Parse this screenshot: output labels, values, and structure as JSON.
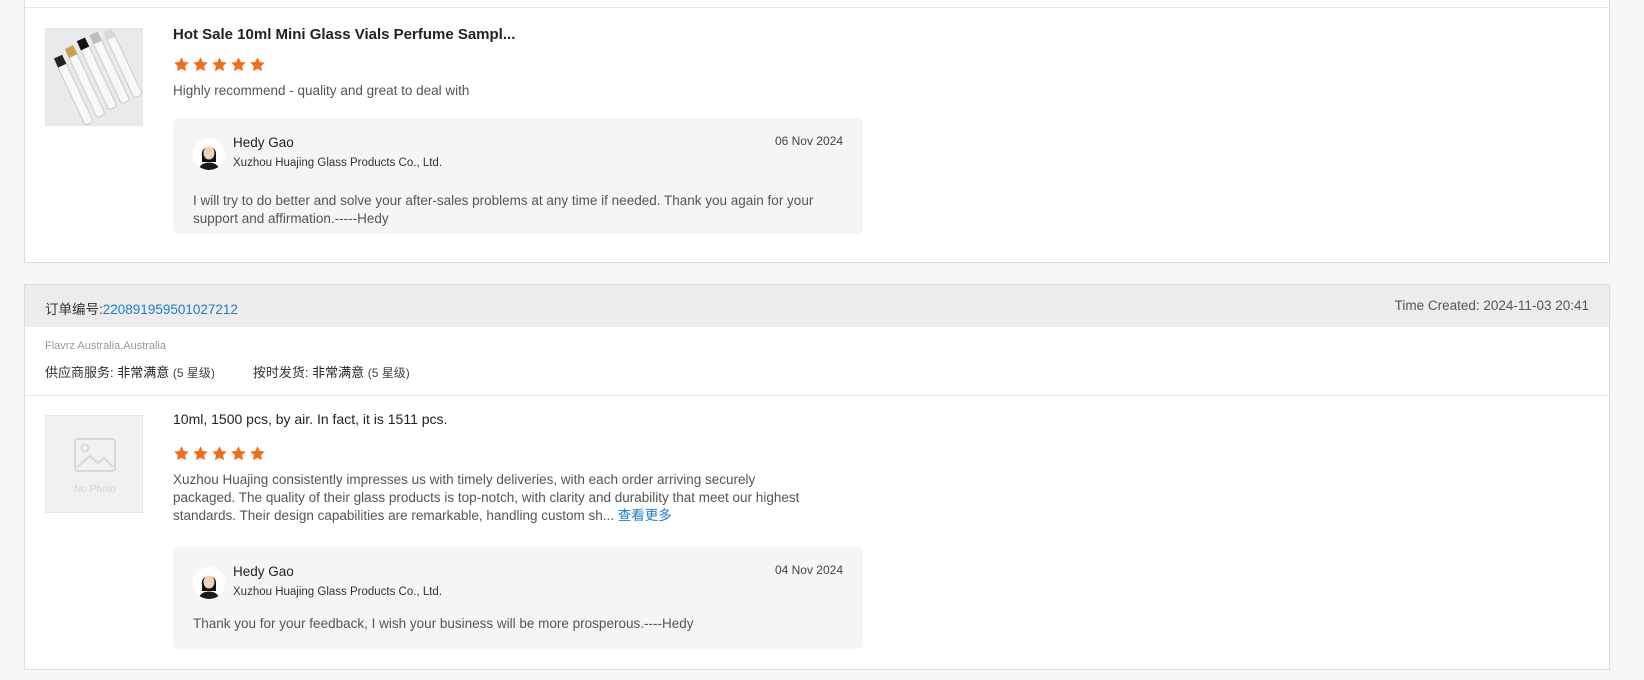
{
  "reviews": [
    {
      "product_title": "Hot Sale 10ml Mini Glass Vials Perfume Sampl...",
      "rating": 5,
      "review_text": "Highly recommend - quality and great to deal with",
      "reply": {
        "name": "Hedy Gao",
        "company": "Xuzhou Huajing Glass Products Co., Ltd.",
        "date": "06 Nov 2024",
        "text": "I will try to do better and solve your after-sales problems at any time if needed. Thank you again for your support and affirmation.-----Hedy"
      }
    },
    {
      "order_label": "订单编号:",
      "order_number": "220891959501027212",
      "time_created": "Time Created: 2024-11-03 20:41",
      "buyer": "Flavrz Australia,Australia",
      "supplier_service_label": "供应商服务:",
      "supplier_service_value": "非常满意",
      "supplier_service_level": "(5 星级)",
      "shipping_label": "按时发货:",
      "shipping_value": "非常满意",
      "shipping_level": "(5 星级)",
      "product_title": "10ml, 1500 pcs, by air. In fact, it is 1511 pcs.",
      "no_photo_label": "No Photo",
      "rating": 5,
      "review_text": "Xuzhou Huajing consistently impresses us with timely deliveries, with each order arriving securely packaged. The quality of their glass products is top-notch, with clarity and durability that meet our highest standards. Their design capabilities are remarkable, handling custom sh...",
      "see_more": "查看更多",
      "reply": {
        "name": "Hedy Gao",
        "company": "Xuzhou Huajing Glass Products Co., Ltd.",
        "date": "04 Nov 2024",
        "text": "Thank you for your feedback, I wish your business will be more prosperous.----Hedy"
      }
    }
  ],
  "colors": {
    "star": "#f26c1a",
    "link": "#1d7ccf"
  },
  "icons": {
    "star": "star-icon",
    "avatar": "avatar-photo",
    "no_photo": "image-placeholder-icon"
  }
}
